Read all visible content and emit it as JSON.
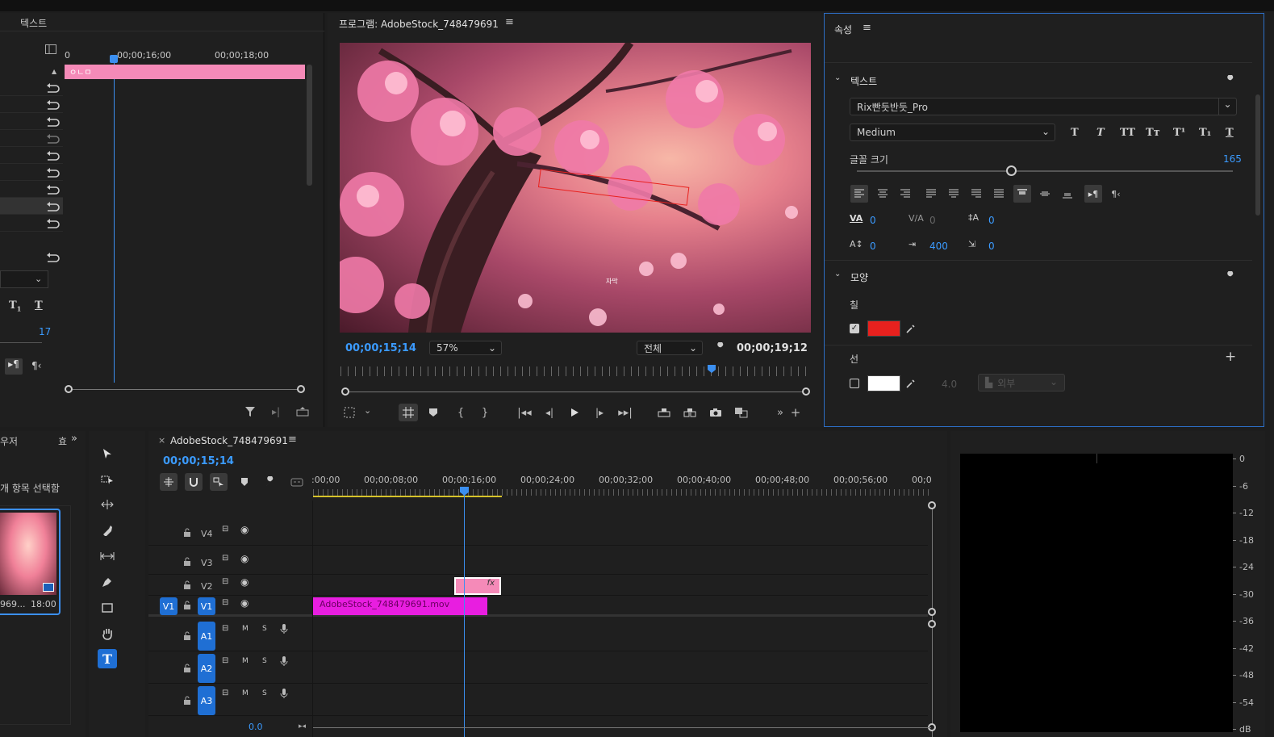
{
  "fx_panel": {
    "tab_label": "텍스트",
    "ruler_times": [
      "0",
      "00;00;16;00",
      "00;00;18;00"
    ],
    "clip_label": "ㅇㄴㅁ",
    "size_value": "17"
  },
  "program": {
    "title": "프로그램: AdobeStock_748479691",
    "current_time": "00;00;15;14",
    "zoom": "57%",
    "quality": "전체",
    "duration": "00;00;19;12",
    "caption_text": "자막"
  },
  "properties": {
    "title": "속성",
    "text_section": "텍스트",
    "font_family": "Rix빤듯반듯_Pro",
    "font_style": "Medium",
    "font_size_label": "글꼴 크기",
    "font_size_value": "165",
    "kerning": "0",
    "tracking": "0",
    "leading": "0",
    "baseline": "0",
    "tsume": "400",
    "tab_value": "0",
    "appearance_section": "모양",
    "fill_label": "칠",
    "fill_color": "#e8211e",
    "stroke_label": "선",
    "stroke_color": "#ffffff",
    "stroke_width": "4.0",
    "stroke_position": "외부"
  },
  "project": {
    "tab_label": "우저",
    "tab2_label": "효",
    "hint_text": "개 항목 선택함",
    "thumb_name": "969...",
    "thumb_duration": "18:00"
  },
  "timeline": {
    "sequence_name": "AdobeStock_748479691",
    "current_time": "00;00;15;14",
    "ruler": [
      ":00;00",
      "00;00;08;00",
      "00;00;16;00",
      "00;00;24;00",
      "00;00;32;00",
      "00;00;40;00",
      "00;00;48;00",
      "00;00;56;00",
      "00;0"
    ],
    "video_tracks": [
      "V4",
      "V3",
      "V2",
      "V1"
    ],
    "audio_tracks": [
      "A1",
      "A2",
      "A3"
    ],
    "source_patch": "V1",
    "clip_name": "AdobeStock_748479691.mov",
    "fx_badge": "fx",
    "mix_value": "0.0",
    "track_m": "M",
    "track_s": "S"
  },
  "meter": {
    "scale": [
      "0",
      "-6",
      "-12",
      "-18",
      "-24",
      "-30",
      "-36",
      "-42",
      "-48",
      "-54",
      "dB"
    ]
  },
  "colors": {
    "accent": "#3b9bff",
    "clip_pink": "#f06aa8",
    "clip_magenta": "#e81ee0",
    "playhead": "#3b8ff0"
  }
}
